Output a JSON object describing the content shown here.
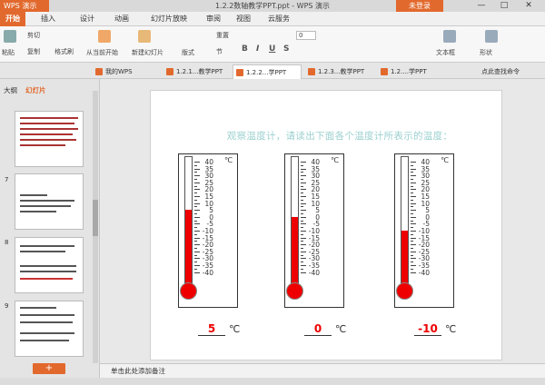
{
  "titlebar": {
    "app": "WPS 演示",
    "doc_title": "1.2.2数轴教学PPT.ppt - WPS 演示",
    "login": "未登录",
    "min": "—",
    "max": "□",
    "close": "✕"
  },
  "menu": [
    "开始",
    "插入",
    "设计",
    "动画",
    "幻灯片放映",
    "审阅",
    "视图",
    "云服务"
  ],
  "ribbon": {
    "paste": "粘贴",
    "cut": "剪切",
    "copy": "复制",
    "format_painter": "格式刷",
    "from_current": "从当前开始",
    "new_slide": "新建幻灯片",
    "layout": "版式",
    "reset": "重置",
    "section": "节",
    "textbox": "文本框",
    "shape": "形状",
    "font_size": "0"
  },
  "tabs": [
    "我的WPS",
    "1.2.1...教学PPT",
    "1.2.2...学PPT",
    "1.2.3...教学PPT",
    "1.2....学PPT"
  ],
  "search": "点此查找命令",
  "left": {
    "tab_outline": "大纲",
    "tab_slides": "幻灯片",
    "slide_nums": [
      "7",
      "8",
      "9"
    ]
  },
  "slide": {
    "heading": "观察温度计，请读出下面各个温度计所表示的温度：",
    "unit": "℃",
    "labels": [
      "40",
      "35",
      "30",
      "25",
      "20",
      "15",
      "10",
      "5",
      "0",
      "-5",
      "-10",
      "-15",
      "-20",
      "-25",
      "-30",
      "-35",
      "-40"
    ],
    "answers": [
      "5",
      "0",
      "-10"
    ],
    "answer_unit": "℃",
    "readings": [
      5,
      0,
      -10
    ]
  },
  "notes": "单击此处添加备注",
  "colors": {
    "accent": "#e2692d",
    "mercury": "#ee0000",
    "heading": "#9dd0d0"
  }
}
